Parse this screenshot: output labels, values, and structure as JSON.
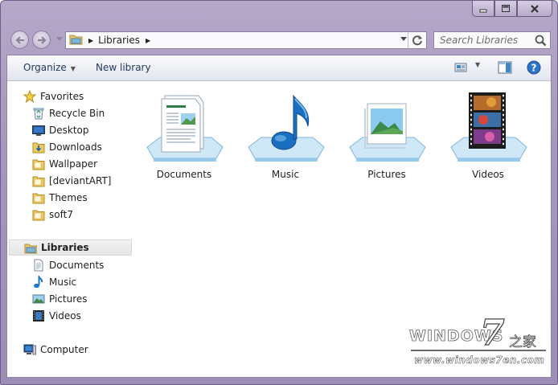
{
  "window": {
    "caption_buttons": [
      "minimize-icon",
      "maximize-icon",
      "close-icon"
    ]
  },
  "address": {
    "root_icon": "libraries-folder-icon",
    "separator": "▶",
    "current": "Libraries",
    "trailing_separator": "▶"
  },
  "search": {
    "placeholder": "Search Libraries"
  },
  "toolbar": {
    "organize_label": "Organize",
    "organize_dropdown": "▼",
    "new_library_label": "New library",
    "view_dropdown": "▼"
  },
  "nav_pane": {
    "favorites": {
      "label": "Favorites",
      "items": [
        {
          "label": "Recycle Bin",
          "icon": "recycle-bin-icon"
        },
        {
          "label": "Desktop",
          "icon": "desktop-icon"
        },
        {
          "label": "Downloads",
          "icon": "downloads-folder-icon"
        },
        {
          "label": "Wallpaper",
          "icon": "folder-icon"
        },
        {
          "label": "[deviantART]",
          "icon": "folder-icon"
        },
        {
          "label": "Themes",
          "icon": "folder-icon"
        },
        {
          "label": "soft7",
          "icon": "folder-icon"
        }
      ]
    },
    "libraries": {
      "label": "Libraries",
      "selected": true,
      "items": [
        {
          "label": "Documents",
          "icon": "documents-icon"
        },
        {
          "label": "Music",
          "icon": "music-icon"
        },
        {
          "label": "Pictures",
          "icon": "pictures-icon"
        },
        {
          "label": "Videos",
          "icon": "videos-icon"
        }
      ]
    },
    "computer": {
      "label": "Computer",
      "icon": "computer-icon"
    }
  },
  "libraries": [
    {
      "label": "Documents",
      "icon": "documents-library-icon"
    },
    {
      "label": "Music",
      "icon": "music-library-icon"
    },
    {
      "label": "Pictures",
      "icon": "pictures-library-icon"
    },
    {
      "label": "Videos",
      "icon": "videos-library-icon"
    }
  ],
  "watermark": {
    "title": "WINDOWS",
    "seven": "7",
    "chinese": "之家",
    "url": "www.windows7en.com"
  },
  "colors": {
    "frame": "#a596bd",
    "accent_blue": "#1e395b",
    "selection": "#e5e5e5"
  }
}
